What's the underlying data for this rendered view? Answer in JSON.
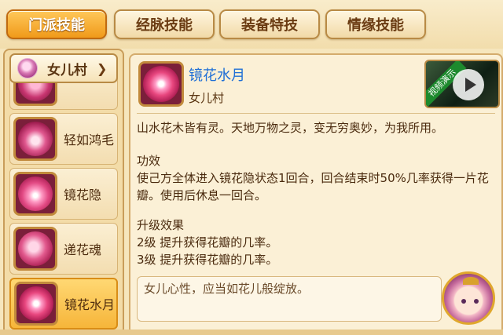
{
  "tabs": [
    {
      "label": "门派技能",
      "active": true
    },
    {
      "label": "经脉技能",
      "active": false
    },
    {
      "label": "装备特技",
      "active": false
    },
    {
      "label": "情缘技能",
      "active": false
    }
  ],
  "school_selector": {
    "value": "女儿村"
  },
  "skills": [
    {
      "name": "",
      "icon": "flower-skill-icon-partial"
    },
    {
      "name": "轻如鸿毛",
      "icon": "crane-feather-icon"
    },
    {
      "name": "镜花隐",
      "icon": "lotus-icon"
    },
    {
      "name": "递花魂",
      "icon": "petal-spirit-icon"
    },
    {
      "name": "镜花水月",
      "icon": "mirror-flower-icon",
      "selected": true
    }
  ],
  "detail": {
    "title": "镜花水月",
    "school": "女儿村",
    "flavor": "山水花木皆有灵。天地万物之灵，变无穷奥妙，为我所用。",
    "effect_heading": "功效",
    "effect_text": "使己方全体进入镜花隐状态1回合，回合结束时50%几率获得一片花瓣。使用后休息一回合。",
    "upgrade_heading": "升级效果",
    "upgrade_lines": [
      "2级 提升获得花瓣的几率。",
      "3级 提升获得花瓣的几率。"
    ],
    "video_label": "视频演示"
  },
  "comment": "女儿心性，应当如花儿般绽放。",
  "colors": {
    "active_tab": "#f09a1a",
    "title_link": "#1f6fd6",
    "panel_bg": "#fbf0d6"
  }
}
